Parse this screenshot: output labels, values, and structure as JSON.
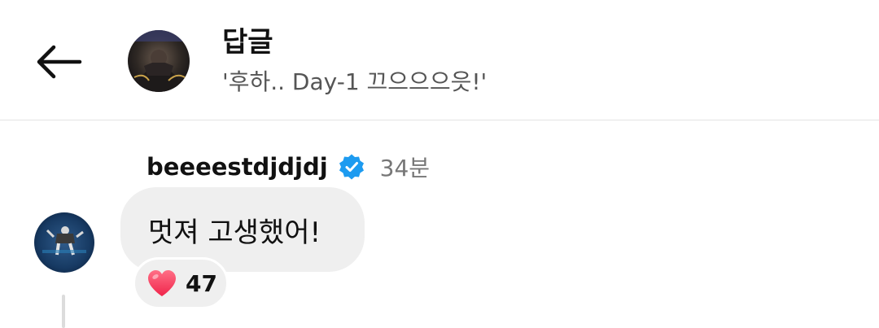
{
  "header": {
    "title": "답글",
    "subtitle": "'후하.. Day-1 끄으으으읏!'",
    "back_icon": "arrow-left-icon"
  },
  "comment": {
    "username": "beeeestdjdjdj",
    "verified_icon": "verified-badge-icon",
    "time": "34분",
    "text": "멋져 고생했어!",
    "reaction": {
      "icon": "heart-icon",
      "count": "47"
    }
  },
  "colors": {
    "verified": "#1d9bf0",
    "bubble": "#efefef",
    "heart": "#ff3c5f",
    "muted_text": "#777777"
  }
}
